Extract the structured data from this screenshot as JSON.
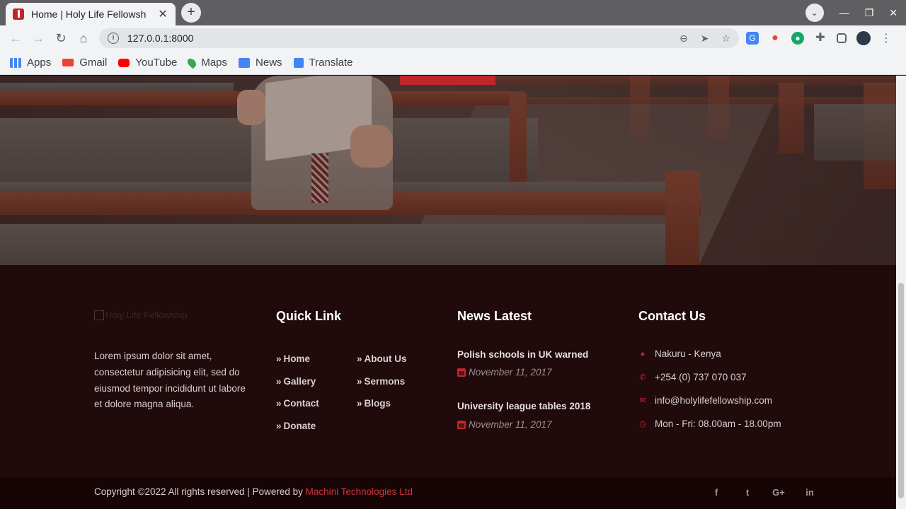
{
  "browser": {
    "tab_title": "Home | Holy Life Fellowsh",
    "url": "127.0.0.1:8000",
    "bookmarks": [
      {
        "label": "Apps",
        "icon": "apps-grid-icon",
        "color": "#4285f4"
      },
      {
        "label": "Gmail",
        "icon": "gmail-icon",
        "color": "#ea4335"
      },
      {
        "label": "YouTube",
        "icon": "youtube-icon",
        "color": "#ff0000"
      },
      {
        "label": "Maps",
        "icon": "maps-pin-icon",
        "color": "#34a853"
      },
      {
        "label": "News",
        "icon": "news-icon",
        "color": "#4285f4"
      },
      {
        "label": "Translate",
        "icon": "translate-icon",
        "color": "#4285f4"
      }
    ]
  },
  "footer": {
    "logo_alt": "Holy Life Fellowship",
    "about": "Lorem ipsum dolor sit amet, consectetur adipisicing elit, sed do eiusmod tempor incididunt ut labore et dolore magna aliqua.",
    "quick_links_heading": "Quick Link",
    "quick_links": [
      "Home",
      "About Us",
      "Gallery",
      "Sermons",
      "Contact",
      "Blogs",
      "Donate"
    ],
    "news_heading": "News Latest",
    "news": [
      {
        "title": "Polish schools in UK warned",
        "date": "November 11, 2017"
      },
      {
        "title": "University league tables 2018",
        "date": "November 11, 2017"
      }
    ],
    "contact_heading": "Contact Us",
    "contact": [
      {
        "icon": "map-marker-icon",
        "text": "Nakuru - Kenya"
      },
      {
        "icon": "phone-icon",
        "text": "+254 (0) 737 070 037"
      },
      {
        "icon": "envelope-icon",
        "text": "info@holylifefellowship.com"
      },
      {
        "icon": "clock-icon",
        "text": "Mon - Fri: 08.00am - 18.00pm"
      }
    ],
    "copyright": "Copyright ©2022 All rights reserved | Powered by ",
    "powered_by": "Machini Technologies Ltd",
    "socials": [
      {
        "icon": "facebook-icon",
        "glyph": "f"
      },
      {
        "icon": "twitter-icon",
        "glyph": "t"
      },
      {
        "icon": "google-plus-icon",
        "glyph": "G+"
      },
      {
        "icon": "linkedin-icon",
        "glyph": "in"
      }
    ]
  },
  "colors": {
    "accent": "#c0272d",
    "footer_bg": "#200a0c",
    "copybar_bg": "#170506"
  }
}
